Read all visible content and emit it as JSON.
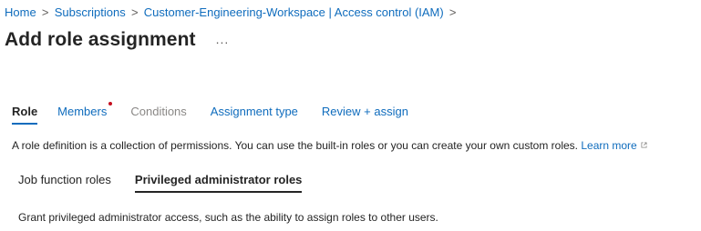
{
  "breadcrumb": {
    "items": [
      "Home",
      "Subscriptions",
      "Customer-Engineering-Workspace | Access control (IAM)"
    ],
    "separator": ">"
  },
  "header": {
    "title": "Add role assignment",
    "more_label": "..."
  },
  "tabs": [
    {
      "label": "Role",
      "state": "active"
    },
    {
      "label": "Members",
      "state": "link",
      "required": true
    },
    {
      "label": "Conditions",
      "state": "disabled"
    },
    {
      "label": "Assignment type",
      "state": "link"
    },
    {
      "label": "Review + assign",
      "state": "link"
    }
  ],
  "description": {
    "text": "A role definition is a collection of permissions. You can use the built-in roles or you can create your own custom roles.",
    "link_label": "Learn more"
  },
  "subtabs": [
    {
      "label": "Job function roles",
      "state": "inactive"
    },
    {
      "label": "Privileged administrator roles",
      "state": "active"
    }
  ],
  "subtab_description": "Grant privileged administrator access, such as the ability to assign roles to other users.",
  "colors": {
    "link": "#0f6cbd",
    "text": "#242424",
    "disabled": "#8a8886",
    "required_dot": "#c50f1f"
  },
  "icons": [
    "chevron-right-icon",
    "external-link-icon",
    "ellipsis-icon"
  ]
}
